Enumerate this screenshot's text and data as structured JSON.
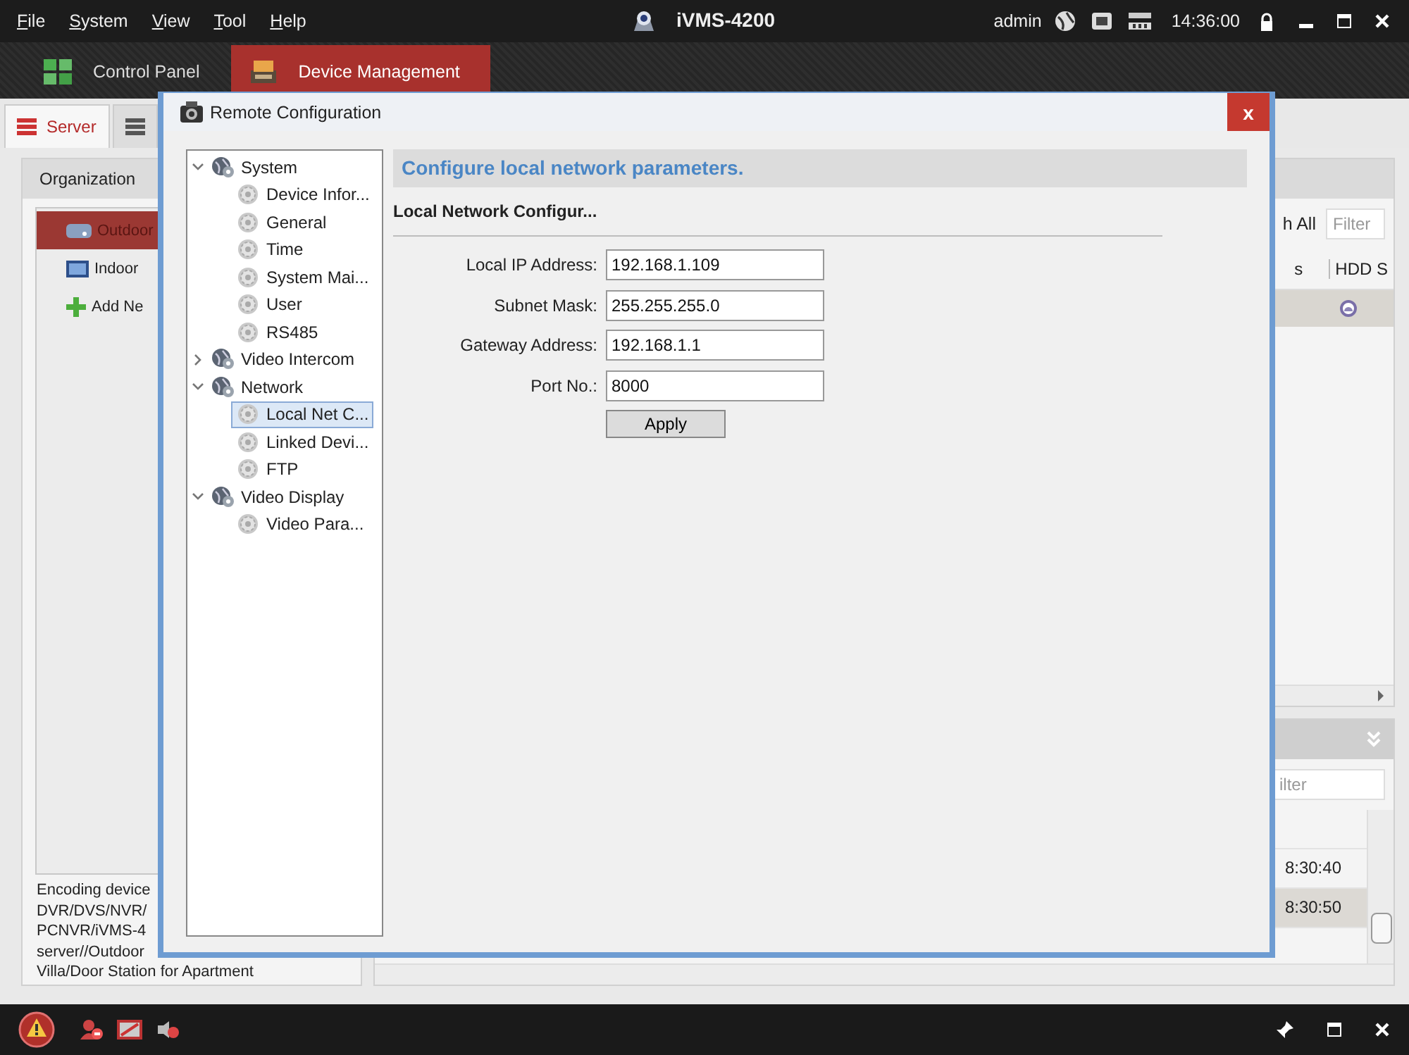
{
  "menu": [
    "File",
    "System",
    "View",
    "Tool",
    "Help"
  ],
  "app_title": "iVMS-4200",
  "user": "admin",
  "clock": "14:36:00",
  "main_tabs": [
    {
      "label": "Control Panel",
      "selected": false,
      "kind": "panel"
    },
    {
      "label": "Device Management",
      "selected": true,
      "kind": "device"
    }
  ],
  "sub_tabs": [
    {
      "label": "Server",
      "selected": true
    },
    {
      "selected": false
    }
  ],
  "organization": {
    "title": "Organization",
    "items": [
      {
        "label": "Outdoor",
        "selected": true,
        "kind": "outdoor"
      },
      {
        "label": "Indoor",
        "selected": false,
        "kind": "indoor"
      },
      {
        "label": "Add Ne",
        "selected": false,
        "kind": "add"
      }
    ]
  },
  "description": [
    "Encoding device",
    "DVR/DVS/NVR/",
    "PCNVR/iVMS-4",
    "server//Outdoor",
    "Villa/Door Station for Apartment"
  ],
  "device_list": {
    "search_label": "h All",
    "filter_placeholder": "Filter",
    "columns": [
      "s",
      "HDD S"
    ],
    "rows": [
      {
        "selected": true
      }
    ]
  },
  "event_log": {
    "filter_placeholder": "ilter",
    "rows": [
      {
        "time": "8:30:40",
        "selected": false
      },
      {
        "time": "8:30:50",
        "selected": true
      }
    ]
  },
  "dialog": {
    "title": "Remote Configuration",
    "close_label": "x",
    "tree": [
      {
        "label": "System",
        "expanded": true,
        "children": [
          {
            "label": "Device Infor...",
            "selected": false
          },
          {
            "label": "General",
            "selected": false
          },
          {
            "label": "Time",
            "selected": false
          },
          {
            "label": "System Mai...",
            "selected": false
          },
          {
            "label": "User",
            "selected": false
          },
          {
            "label": "RS485",
            "selected": false
          }
        ]
      },
      {
        "label": "Video Intercom",
        "expanded": false
      },
      {
        "label": "Network",
        "expanded": true,
        "children": [
          {
            "label": "Local Net C...",
            "selected": true
          },
          {
            "label": "Linked Devi...",
            "selected": false
          },
          {
            "label": "FTP",
            "selected": false
          }
        ]
      },
      {
        "label": "Video Display",
        "expanded": true,
        "children": [
          {
            "label": "Video Para...",
            "selected": false
          }
        ]
      }
    ],
    "heading": "Configure local network parameters.",
    "section": "Local Network Configur...",
    "fields": [
      {
        "label": "Local IP Address:",
        "value": "192.168.1.109"
      },
      {
        "label": "Subnet Mask:",
        "value": "255.255.255.0"
      },
      {
        "label": "Gateway Address:",
        "value": "192.168.1.1"
      },
      {
        "label": "Port No.:",
        "value": "8000"
      }
    ],
    "apply": "Apply"
  }
}
